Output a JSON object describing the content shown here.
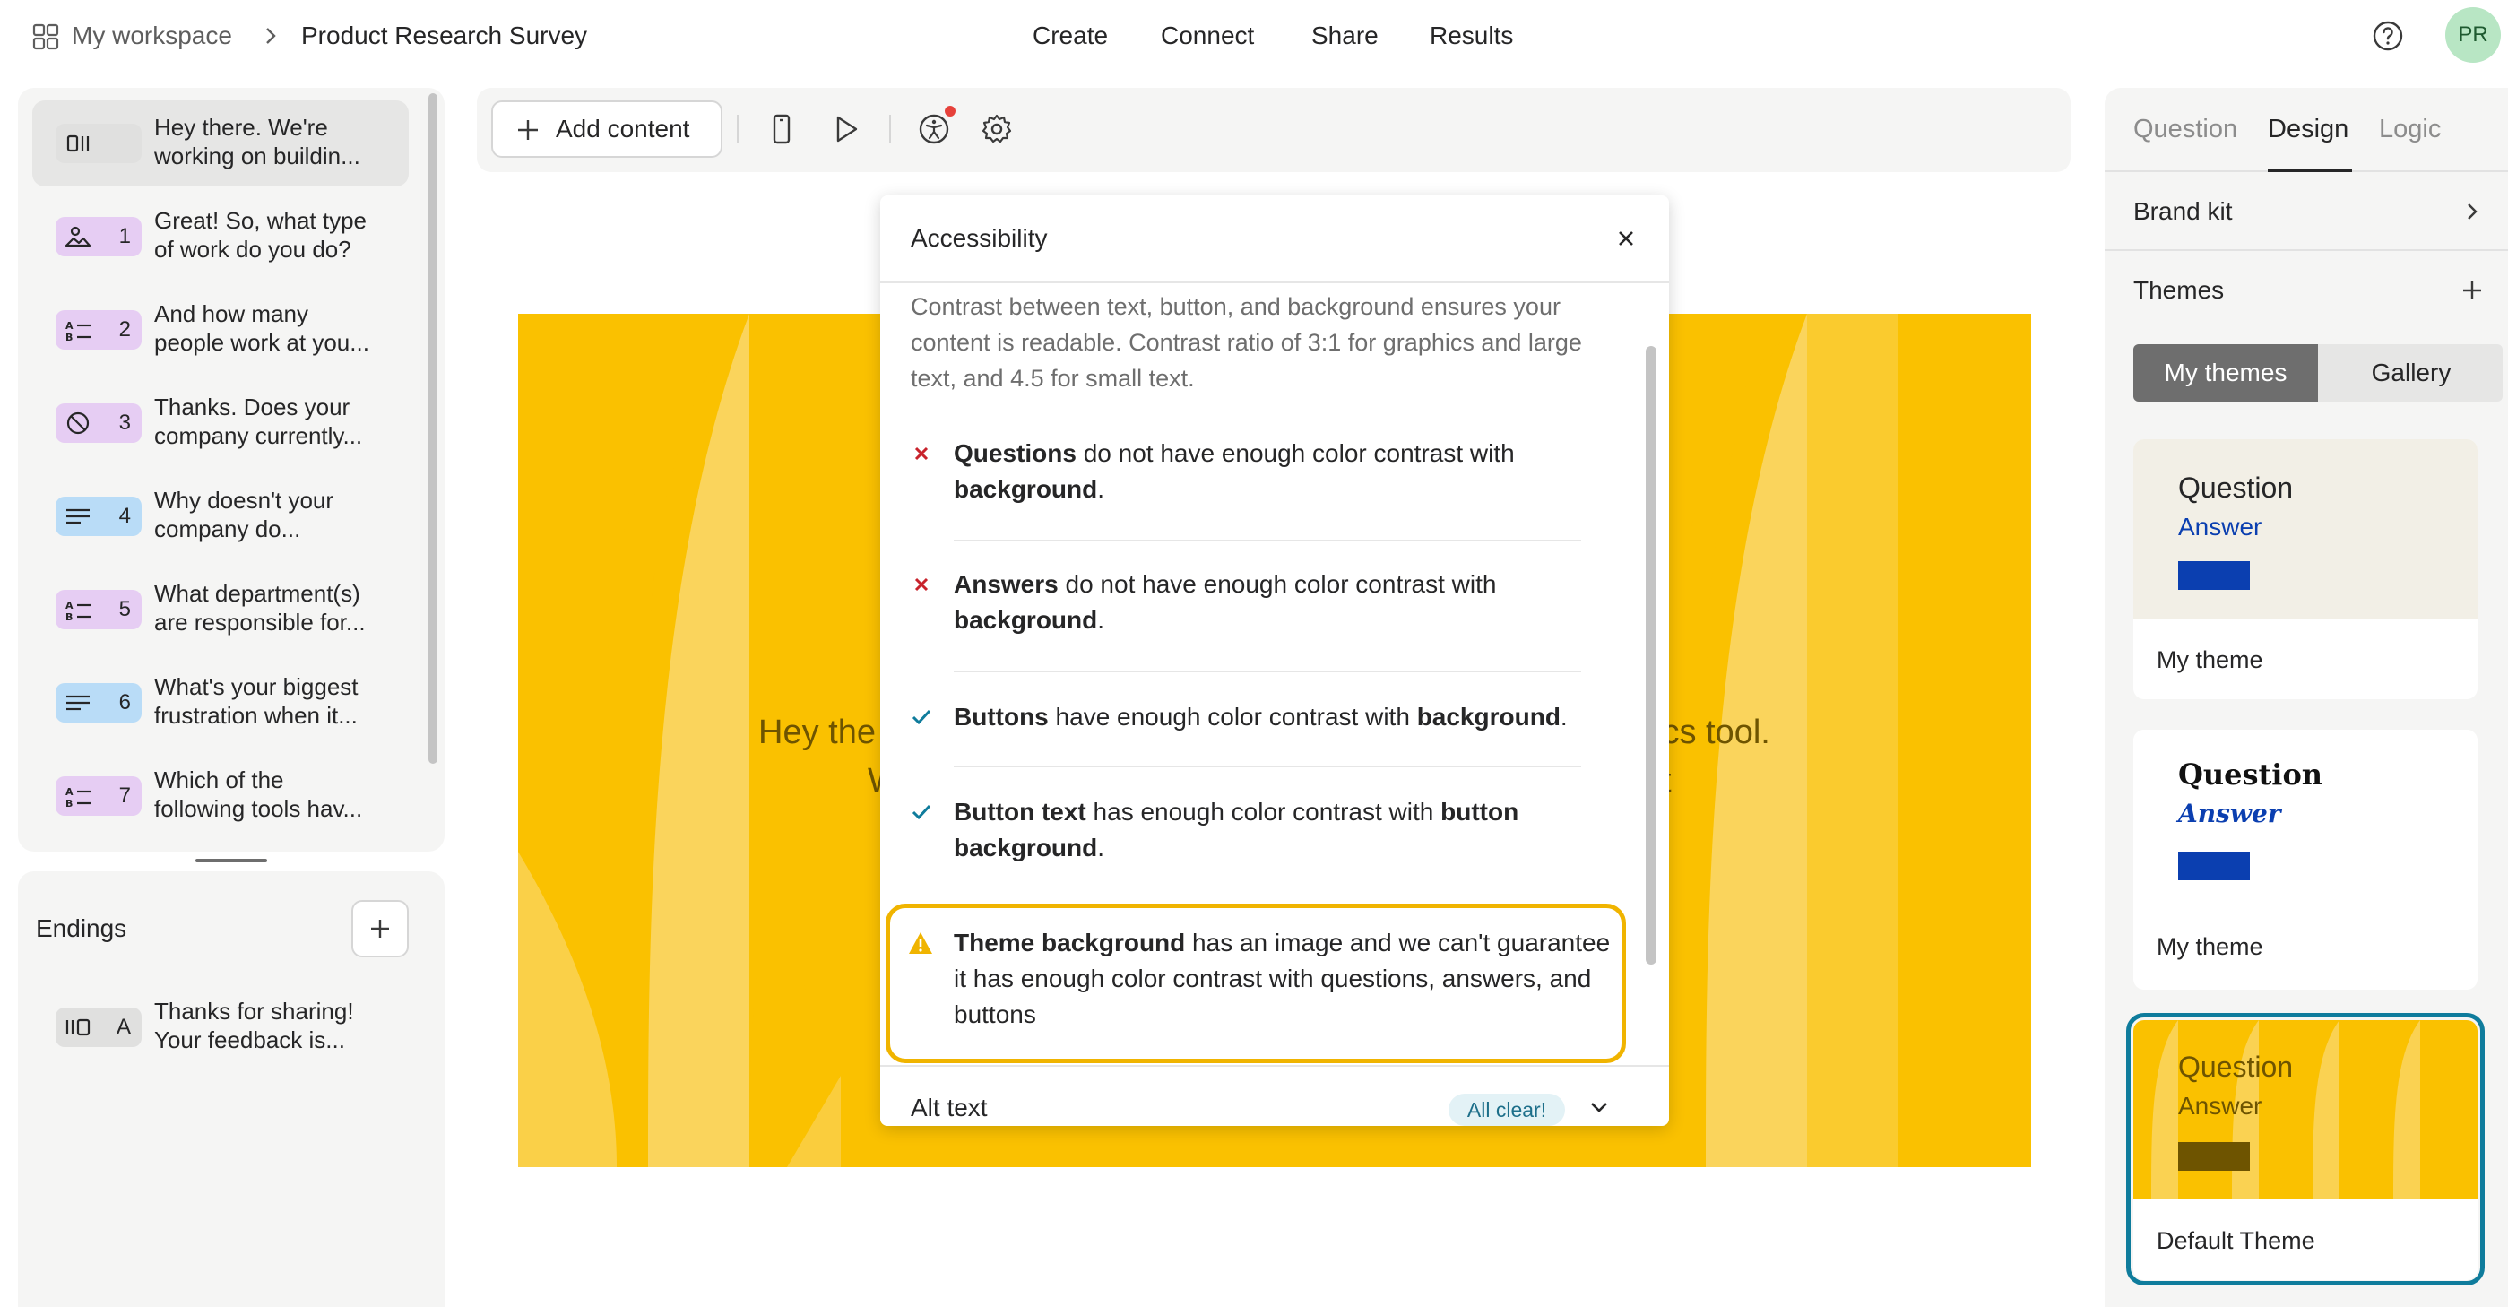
{
  "header": {
    "workspace": "My workspace",
    "survey_title": "Product Research Survey",
    "nav": [
      "Create",
      "Connect",
      "Share",
      "Results"
    ],
    "avatar_initials": "PR"
  },
  "questions": [
    {
      "num": "",
      "line1": "Hey there. We're",
      "line2": "working on buildin...",
      "icon": "statement-icon",
      "color": "#e0e0df"
    },
    {
      "num": "1",
      "line1": "Great! So, what type",
      "line2": "of work do you do?",
      "icon": "picture-choice-icon",
      "color": "#e6cdf3"
    },
    {
      "num": "2",
      "line1": "And how many",
      "line2": "people work at you...",
      "icon": "multiple-choice-icon",
      "color": "#e6cdf3"
    },
    {
      "num": "3",
      "line1": "Thanks. Does your",
      "line2": "company currently...",
      "icon": "yes-no-icon",
      "color": "#e6cdf3"
    },
    {
      "num": "4",
      "line1": "Why doesn't your",
      "line2": "company do...",
      "icon": "long-text-icon",
      "color": "#b9dcf7"
    },
    {
      "num": "5",
      "line1": "What department(s)",
      "line2": "are responsible for...",
      "icon": "multiple-choice-icon",
      "color": "#e6cdf3"
    },
    {
      "num": "6",
      "line1": "What's your biggest",
      "line2": "frustration when it...",
      "icon": "long-text-icon",
      "color": "#b9dcf7"
    },
    {
      "num": "7",
      "line1": "Which of the",
      "line2": "following tools hav...",
      "icon": "multiple-choice-icon",
      "color": "#e6cdf3"
    }
  ],
  "endings": {
    "title": "Endings",
    "items": [
      {
        "num": "A",
        "line1": "Thanks for sharing!",
        "line2": "Your feedback is..."
      }
    ]
  },
  "toolbar": {
    "add_content": "Add content"
  },
  "canvas": {
    "text_left_1": "Hey the",
    "text_right_1": "ics tool.",
    "text_left_2": "W",
    "text_right_2": "t"
  },
  "accessibility": {
    "title": "Accessibility",
    "description": "Contrast between text, button, and background ensures your content is readable. Contrast ratio of 3:1 for graphics and large text, and 4.5 for small text.",
    "checks": [
      {
        "status": "fail",
        "bold1": "Questions",
        "text1": " do not have enough color contrast with ",
        "bold2": "background",
        "text2": "."
      },
      {
        "status": "fail",
        "bold1": "Answers",
        "text1": " do not have enough color contrast with ",
        "bold2": "background",
        "text2": "."
      },
      {
        "status": "pass",
        "bold1": "Buttons",
        "text1": " have enough color contrast with ",
        "bold2": "background",
        "text2": "."
      },
      {
        "status": "pass",
        "bold1": "Button text",
        "text1": " has enough color contrast with ",
        "bold2": "button background",
        "text2": "."
      },
      {
        "status": "warning",
        "bold1": "Theme background",
        "text1": " has an image and we can't guarantee it has enough color contrast with questions, answers, and buttons",
        "bold2": "",
        "text2": ""
      }
    ],
    "alt_text_title": "Alt text",
    "alt_text_status": "All clear!"
  },
  "right_panel": {
    "tabs": [
      "Question",
      "Design",
      "Logic"
    ],
    "active_tab": "Design",
    "brand_kit": "Brand kit",
    "themes_title": "Themes",
    "segment": [
      "My themes",
      "Gallery"
    ],
    "themes": [
      {
        "question": "Question",
        "answer": "Answer",
        "name": "My theme",
        "bg": "#f2efe6",
        "q_color": "#262627",
        "a_color": "#0b3fb0",
        "btn": "#0b3fb0"
      },
      {
        "question": "Question",
        "answer": "Answer",
        "name": "My theme",
        "bg": "#ffffff",
        "q_color": "#111111",
        "a_color": "#0b3fb0",
        "btn": "#0b3fb0"
      },
      {
        "question": "Question",
        "answer": "Answer",
        "name": "Default Theme",
        "bg": "#fac100",
        "q_color": "#6e5400",
        "a_color": "#6e5400",
        "btn": "#6e5400"
      }
    ]
  },
  "colors": {
    "accent_yellow": "#fac100",
    "selected_border": "#0f7c9c",
    "warning": "#f0b400",
    "fail": "#c8232c",
    "pass": "#0f7c9c"
  }
}
